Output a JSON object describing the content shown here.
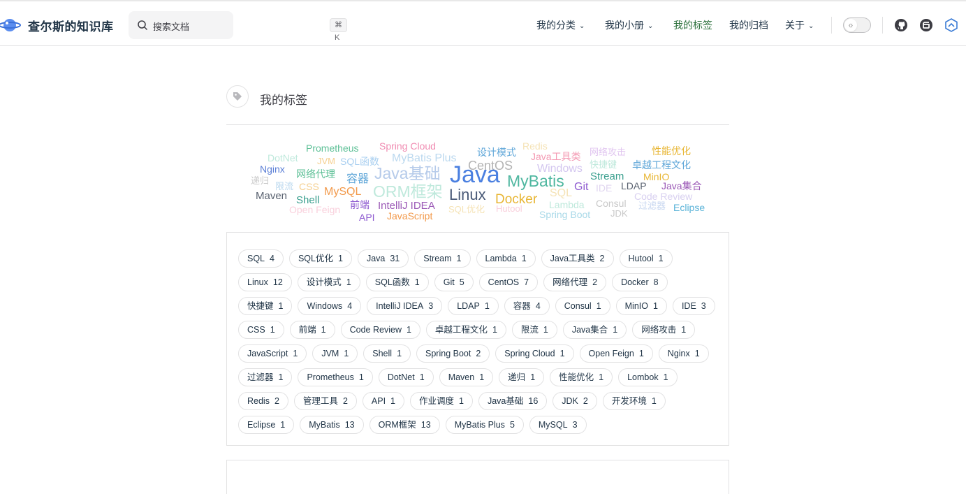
{
  "site": {
    "title": "查尔斯的知识库"
  },
  "search": {
    "placeholder": "搜索文档",
    "shortcut": "⌘ K"
  },
  "nav": [
    {
      "label": "我的分类",
      "dropdown": true
    },
    {
      "label": "我的小册",
      "dropdown": true
    },
    {
      "label": "我的标签",
      "active": true
    },
    {
      "label": "我的归档"
    },
    {
      "label": "关于",
      "dropdown": true
    }
  ],
  "social": [
    "github-icon",
    "gitee-icon",
    "blog-icon"
  ],
  "page": {
    "heading": "我的标签",
    "icon": "tag-icon"
  },
  "cloud": [
    {
      "text": "DotNet",
      "color": "#bfe9dc"
    },
    {
      "text": "Prometheus",
      "color": "#5bbf95"
    },
    {
      "text": "Spring Cloud",
      "color": "#f08cb2"
    },
    {
      "text": "MyBatis Plus",
      "color": "#bcd9ef"
    },
    {
      "text": "设计模式",
      "color": "#5ea6d8"
    },
    {
      "text": "Redis",
      "color": "#f5e3b6"
    },
    {
      "text": "Java工具类",
      "color": "#f49ab3"
    },
    {
      "text": "网络攻击",
      "color": "#e1c6f0"
    },
    {
      "text": "性能优化",
      "color": "#e8b634"
    },
    {
      "text": "JVM",
      "color": "#f5cf8f"
    },
    {
      "text": "SQL函数",
      "color": "#a9cff0"
    },
    {
      "text": "CentOS",
      "color": "#b3b3b3"
    },
    {
      "text": "快捷键",
      "color": "#bfe9dc"
    },
    {
      "text": "卓越工程文化",
      "color": "#5ea6d8"
    },
    {
      "text": "Nginx",
      "color": "#5b7fd6"
    },
    {
      "text": "网络代理",
      "color": "#5bbf95"
    },
    {
      "text": "Java基础",
      "color": "#b6cbea"
    },
    {
      "text": "Java",
      "color": "#4a7fe0"
    },
    {
      "text": "Windows",
      "color": "#d3c6ef"
    },
    {
      "text": "递归",
      "color": "#c9c9c9"
    },
    {
      "text": "容器",
      "color": "#5ea6d8"
    },
    {
      "text": "MyBatis",
      "color": "#4fb7a0"
    },
    {
      "text": "Stream",
      "color": "#3a9f8e"
    },
    {
      "text": "MinIO",
      "color": "#e8b634"
    },
    {
      "text": "限流",
      "color": "#bcd9ef"
    },
    {
      "text": "CSS",
      "color": "#f5cf8f"
    },
    {
      "text": "ORM框架",
      "color": "#bfe9dc"
    },
    {
      "text": "Git",
      "color": "#8e5bd0"
    },
    {
      "text": "IDE",
      "color": "#e1d6f0"
    },
    {
      "text": "LDAP",
      "color": "#5a6270"
    },
    {
      "text": "Java集合",
      "color": "#9b59b6"
    },
    {
      "text": "Maven",
      "color": "#5a6270"
    },
    {
      "text": "MySQL",
      "color": "#f2994a"
    },
    {
      "text": "Linux",
      "color": "#4a5a78"
    },
    {
      "text": "Docker",
      "color": "#e8b634"
    },
    {
      "text": "SQL",
      "color": "#f5e3b6"
    },
    {
      "text": "Code Review",
      "color": "#d8d0f0"
    },
    {
      "text": "Shell",
      "color": "#3a9f8e"
    },
    {
      "text": "Lambda",
      "color": "#bfe9dc"
    },
    {
      "text": "Consul",
      "color": "#c9c9c9"
    },
    {
      "text": "Open Feign",
      "color": "#f9d0dc"
    },
    {
      "text": "前端",
      "color": "#8e5bd0"
    },
    {
      "text": "IntelliJ IDEA",
      "color": "#9b59b6"
    },
    {
      "text": "SQL优化",
      "color": "#f5e3b6"
    },
    {
      "text": "Hutool",
      "color": "#f9d0dc"
    },
    {
      "text": "过滤器",
      "color": "#c6d6f0"
    },
    {
      "text": "Eclipse",
      "color": "#5ab3d8"
    },
    {
      "text": "API",
      "color": "#8e5bd0"
    },
    {
      "text": "JavaScript",
      "color": "#f2994a"
    },
    {
      "text": "Spring Boot",
      "color": "#a9d9e8"
    },
    {
      "text": "JDK",
      "color": "#c9c9c9"
    }
  ],
  "tags": [
    [
      {
        "name": "SQL",
        "count": "4"
      },
      {
        "name": "SQL优化",
        "count": "1"
      },
      {
        "name": "Java",
        "count": "31"
      },
      {
        "name": "Stream",
        "count": "1"
      },
      {
        "name": "Lambda",
        "count": "1"
      },
      {
        "name": "Java工具类",
        "count": "2"
      },
      {
        "name": "Hutool",
        "count": "1"
      }
    ],
    [
      {
        "name": "Linux",
        "count": "12"
      },
      {
        "name": "设计模式",
        "count": "1"
      },
      {
        "name": "SQL函数",
        "count": "1"
      },
      {
        "name": "Git",
        "count": "5"
      },
      {
        "name": "CentOS",
        "count": "7"
      },
      {
        "name": "网络代理",
        "count": "2"
      },
      {
        "name": "Docker",
        "count": "8"
      }
    ],
    [
      {
        "name": "快捷键",
        "count": "1"
      },
      {
        "name": "Windows",
        "count": "4"
      },
      {
        "name": "IntelliJ IDEA",
        "count": "3"
      },
      {
        "name": "LDAP",
        "count": "1"
      },
      {
        "name": "容器",
        "count": "4"
      },
      {
        "name": "Consul",
        "count": "1"
      },
      {
        "name": "MinIO",
        "count": "1"
      },
      {
        "name": "IDE",
        "count": "3"
      }
    ],
    [
      {
        "name": "CSS",
        "count": "1"
      },
      {
        "name": "前端",
        "count": "1"
      },
      {
        "name": "Code Review",
        "count": "1"
      },
      {
        "name": "卓越工程文化",
        "count": "1"
      },
      {
        "name": "限流",
        "count": "1"
      },
      {
        "name": "Java集合",
        "count": "1"
      },
      {
        "name": "网络攻击",
        "count": "1"
      }
    ],
    [
      {
        "name": "JavaScript",
        "count": "1"
      },
      {
        "name": "JVM",
        "count": "1"
      },
      {
        "name": "Shell",
        "count": "1"
      },
      {
        "name": "Spring Boot",
        "count": "2"
      },
      {
        "name": "Spring Cloud",
        "count": "1"
      },
      {
        "name": "Open Feign",
        "count": "1"
      },
      {
        "name": "Nginx",
        "count": "1"
      }
    ],
    [
      {
        "name": "过滤器",
        "count": "1"
      },
      {
        "name": "Prometheus",
        "count": "1"
      },
      {
        "name": "DotNet",
        "count": "1"
      },
      {
        "name": "Maven",
        "count": "1"
      },
      {
        "name": "递归",
        "count": "1"
      },
      {
        "name": "性能优化",
        "count": "1"
      },
      {
        "name": "Lombok",
        "count": "1"
      }
    ],
    [
      {
        "name": "Redis",
        "count": "2"
      },
      {
        "name": "管理工具",
        "count": "2"
      },
      {
        "name": "API",
        "count": "1"
      },
      {
        "name": "作业调度",
        "count": "1"
      },
      {
        "name": "Java基础",
        "count": "16"
      },
      {
        "name": "JDK",
        "count": "2"
      },
      {
        "name": "开发环境",
        "count": "1"
      }
    ],
    [
      {
        "name": "Eclipse",
        "count": "1"
      },
      {
        "name": "MyBatis",
        "count": "13"
      },
      {
        "name": "ORM框架",
        "count": "13"
      },
      {
        "name": "MyBatis Plus",
        "count": "5"
      },
      {
        "name": "MySQL",
        "count": "3"
      }
    ]
  ]
}
